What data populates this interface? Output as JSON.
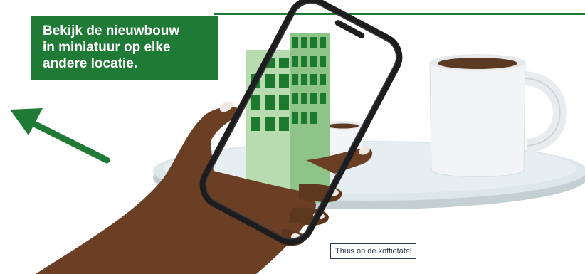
{
  "promo": {
    "heading": "Bekijk de nieuwbouw\nin miniatuur op elke\nandere locatie."
  },
  "caption": {
    "label": "Thuis op de koffietafel"
  },
  "colors": {
    "brand_green": "#1f7a35",
    "building_green": "#a9d3a0",
    "window_green": "#1c7a2e",
    "table_top": "#dde6ea",
    "table_edge": "#b9c6cc",
    "coffee": "#5a3a22"
  },
  "icons": {
    "arrow": "arrow-up-left-icon"
  }
}
